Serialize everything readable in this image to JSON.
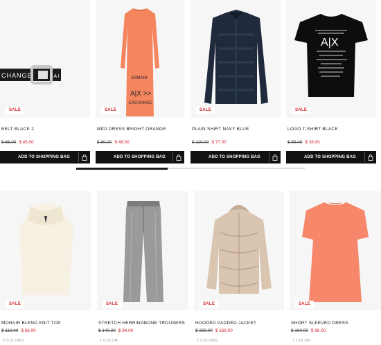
{
  "row1": [
    {
      "name": "BELT BLACK 2",
      "old_price": "$ 65.00",
      "new_price": "$ 45.00",
      "badge": "SALE",
      "button": "ADD TO SHOPPING BAG"
    },
    {
      "name": "MIDI DRESS BRIGHT ORANGE",
      "old_price": "$ 80.00",
      "new_price": "$ 48.00",
      "badge": "SALE",
      "button": "ADD TO SHOPPING BAG"
    },
    {
      "name": "PLAIN SHIRT NAVY BLUE",
      "old_price": "$ 110.00",
      "new_price": "$ 77.00",
      "badge": "SALE",
      "button": "ADD TO SHOPPING BAG"
    },
    {
      "name": "LOGO T-SHIRT BLACK",
      "old_price": "$ 55.00",
      "new_price": "$ 38.00",
      "badge": "SALE",
      "button": "ADD TO SHOPPING BAG"
    }
  ],
  "row2": [
    {
      "name": "MOHAIR BLEND KNIT TOP",
      "old_price": "$ 110.00",
      "new_price": "$ 66.00",
      "badge": "SALE",
      "colors": "2 COLORS"
    },
    {
      "name": "STRETCH HERRINGBONE TROUSERS",
      "old_price": "$ 140.00",
      "new_price": "$ 84.00",
      "badge": "SALE",
      "colors": "1 COLOR"
    },
    {
      "name": "HOODED PADDED JACKET",
      "old_price": "$ 280.00",
      "new_price": "$ 168.00",
      "badge": "SALE",
      "colors": "2 COLORS"
    },
    {
      "name": "SHORT SLEEVED DRESS",
      "old_price": "$ 160.00",
      "new_price": "$ 96.00",
      "badge": "SALE",
      "colors": "1 COLOR"
    }
  ],
  "product_text": {
    "belt_buckle_text": "CHANGE",
    "belt_strap_text": "I A I D",
    "dress_print_lines": [
      "ARMANI",
      "A|X >>",
      "EXCHANGE"
    ],
    "tshirt_logo": "A|X"
  },
  "carousel": {
    "position_fraction": 0.4
  },
  "colors": {
    "sale_red": "#d2232a",
    "button_black": "#111111",
    "image_bg": "#f6f6f6"
  },
  "icons": {
    "bag_icon": "shopping-bag-icon"
  }
}
